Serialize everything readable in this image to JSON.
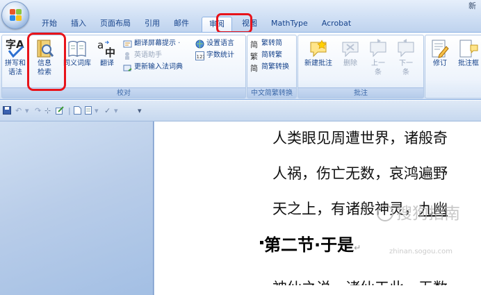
{
  "window": {
    "title": "新"
  },
  "tabs": [
    {
      "label": "开始"
    },
    {
      "label": "插入"
    },
    {
      "label": "页面布局"
    },
    {
      "label": "引用"
    },
    {
      "label": "邮件"
    },
    {
      "label": "审阅"
    },
    {
      "label": "视图"
    },
    {
      "label": "MathType"
    },
    {
      "label": "Acrobat"
    }
  ],
  "ribbon": {
    "proofing": {
      "label": "校对",
      "spelling": {
        "line1": "拼写和",
        "line2": "语法"
      },
      "research": {
        "line1": "信息",
        "line2": "检索"
      },
      "thesaurus": {
        "label": "同义词库"
      },
      "translate": {
        "label": "翻译"
      },
      "small": {
        "translate_tip": "翻译屏幕提示 ·",
        "english_assist": "英语助手",
        "update_ime": "更新输入法词典",
        "set_language": "设置语言",
        "word_count": "字数统计"
      }
    },
    "chinese": {
      "label": "中文简繁转换",
      "to_simplified": "繁转简",
      "to_traditional": "简转繁",
      "convert": "简繁转换"
    },
    "comments": {
      "label": "批注",
      "new_comment": "新建批注",
      "delete": "删除",
      "previous": {
        "line1": "上一",
        "line2": "条"
      },
      "next": {
        "line1": "下一",
        "line2": "条"
      }
    },
    "tracking": {
      "track_changes": "修订",
      "balloons": "批注框"
    }
  },
  "document": {
    "lines": [
      "人类眼见周遭世界，诸般奇",
      "人祸，伤亡无数，哀鸿遍野",
      "天之上，有诸般神灵，"
    ],
    "line3_underlined": "九幽",
    "heading": "第二节·于是",
    "last_line": "神仙之说，诸仙天此，无数"
  },
  "watermark": {
    "main": "搜狗指南",
    "sub": "zhinan.sogou.com"
  },
  "colors": {
    "highlight": "#e8131a",
    "ribbon_text": "#15428b",
    "accent": "#8db2e3"
  }
}
